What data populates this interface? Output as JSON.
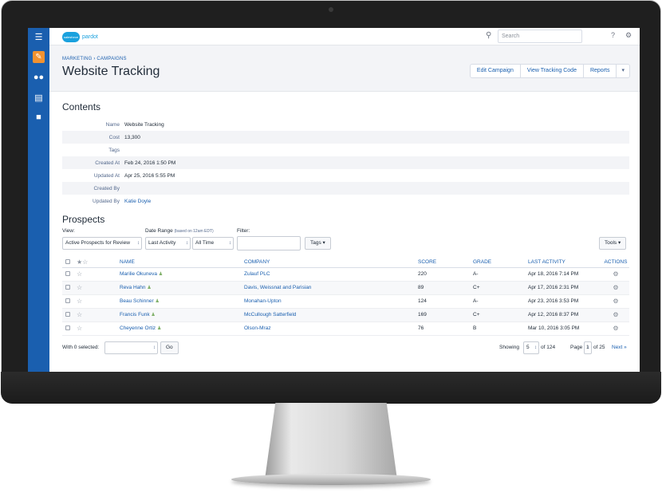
{
  "app": {
    "logo_cloud": "salesforce",
    "logo_text": "pardot"
  },
  "topbar": {
    "search_placeholder": "Search",
    "help_icon": "?",
    "settings_icon": "gear-icon",
    "user_icon": "user-icon"
  },
  "rail": {
    "items": [
      "menu-icon",
      "pencil-icon",
      "people-icon",
      "report-icon",
      "briefcase-icon"
    ]
  },
  "breadcrumb": "MARKETING › CAMPAIGNS",
  "page_title": "Website Tracking",
  "header_buttons": {
    "edit": "Edit Campaign",
    "tracking": "View Tracking Code",
    "reports": "Reports",
    "more": "▾"
  },
  "contents": {
    "title": "Contents",
    "rows": [
      {
        "label": "Name",
        "value": "Website Tracking"
      },
      {
        "label": "Cost",
        "value": "13,300"
      },
      {
        "label": "Tags",
        "value": ""
      },
      {
        "label": "Created At",
        "value": "Feb 24, 2016 1:50 PM"
      },
      {
        "label": "Updated At",
        "value": "Apr 25, 2016 5:55 PM"
      },
      {
        "label": "Created By",
        "value": ""
      },
      {
        "label": "Updated By",
        "value": "Katie Doyle"
      }
    ]
  },
  "prospects": {
    "title": "Prospects",
    "view_label": "View:",
    "view_value": "Active Prospects for Review",
    "date_range_label": "Date Range",
    "date_range_note": "(based on 12am EDT)",
    "date_field_value": "Last Activity",
    "date_period_value": "All Time",
    "filter_label": "Filter:",
    "filter_value": "",
    "tags_button": "Tags ▾",
    "tools_button": "Tools ▾",
    "columns": [
      "NAME",
      "COMPANY",
      "SCORE",
      "GRADE",
      "LAST ACTIVITY",
      "ACTIONS"
    ],
    "rows": [
      {
        "name": "Marilie Okuneva",
        "company": "Zulauf PLC",
        "score": "220",
        "grade": "A-",
        "last_activity": "Apr 18, 2016 7:14 PM"
      },
      {
        "name": "Reva Hahn",
        "company": "Davis, Weissnat and Parisian",
        "score": "89",
        "grade": "C+",
        "last_activity": "Apr 17, 2016 2:31 PM"
      },
      {
        "name": "Beau Schinner",
        "company": "Monahan-Upton",
        "score": "124",
        "grade": "A-",
        "last_activity": "Apr 23, 2016 3:53 PM"
      },
      {
        "name": "Francis Funk",
        "company": "McCullough Satterfield",
        "score": "169",
        "grade": "C+",
        "last_activity": "Apr 12, 2016 8:37 PM"
      },
      {
        "name": "Cheyenne Ortiz",
        "company": "Olson-Mraz",
        "score": "76",
        "grade": "B",
        "last_activity": "Mar 10, 2016 3:05 PM"
      }
    ],
    "footer": {
      "selected_label": "With 0 selected:",
      "bulk_action_value": "",
      "go_button": "Go",
      "showing_label": "Showing",
      "showing_value": "5",
      "of_total": "of 124",
      "page_label": "Page",
      "page_value": "1",
      "of_pages": "of 25",
      "next_link": "Next »"
    }
  },
  "colors": {
    "accent": "#1a5faf",
    "rail_active": "#f29230",
    "header_band": "#f3f4f7"
  }
}
